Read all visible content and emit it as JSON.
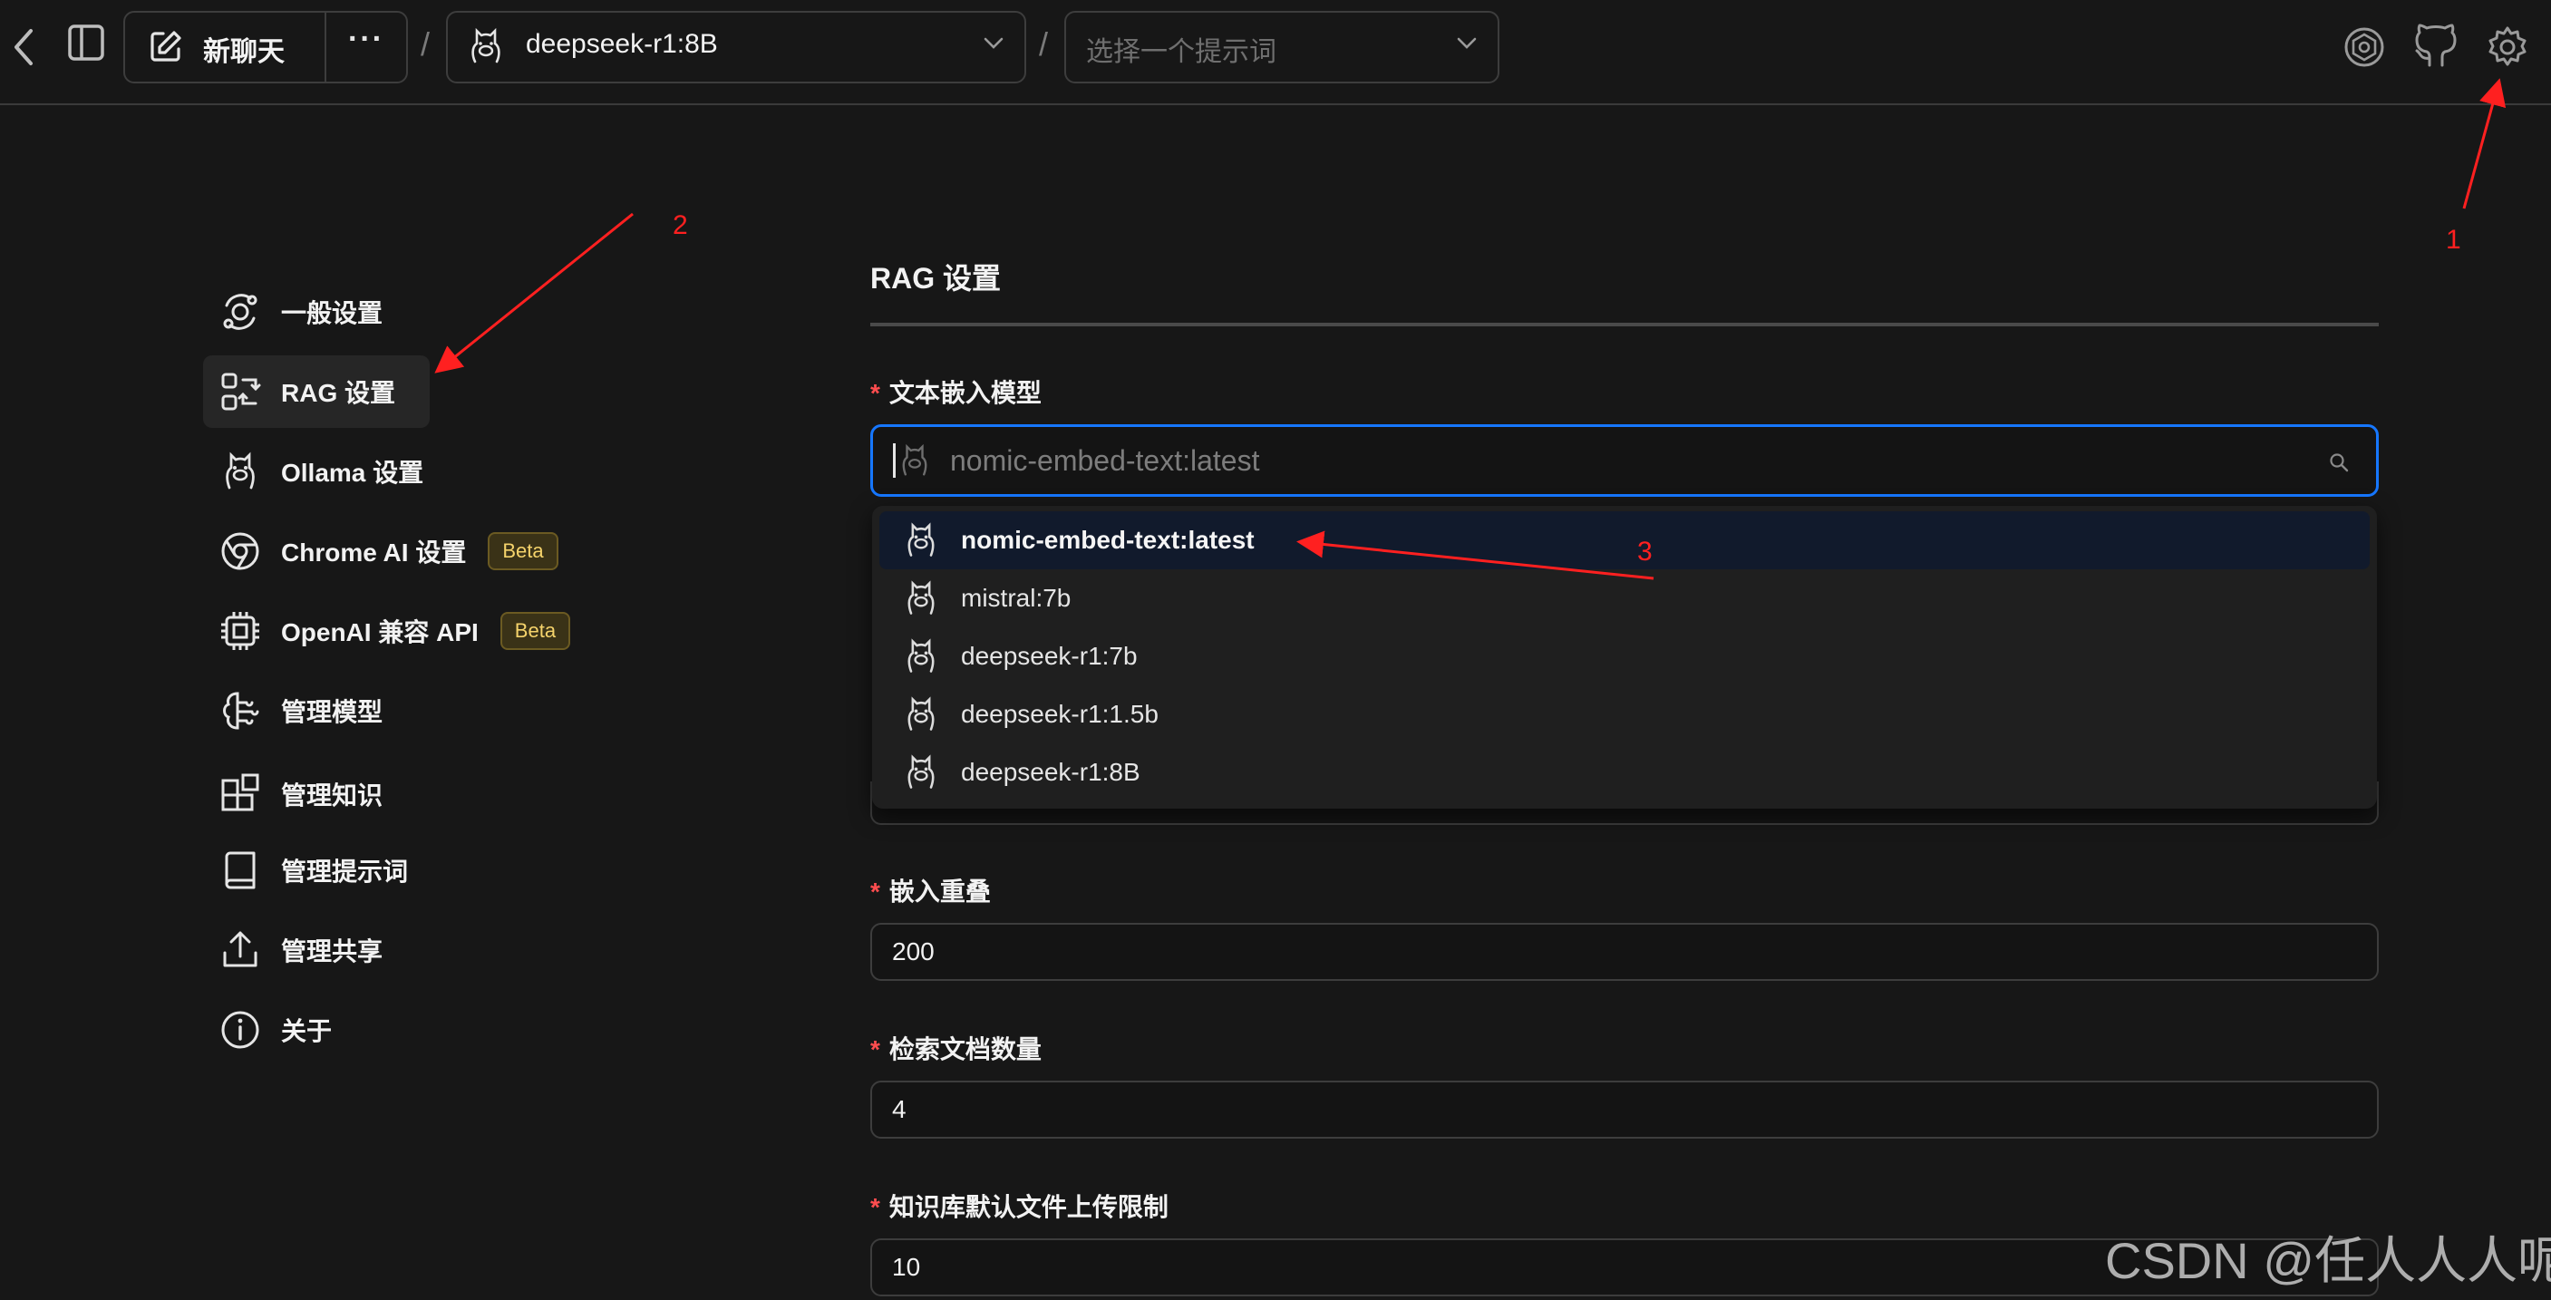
{
  "topbar": {
    "new_chat_label": "新聊天",
    "more_label": "···",
    "separator": "/",
    "model_selected": "deepseek-r1:8B",
    "prompt_placeholder": "选择一个提示词"
  },
  "sidebar": {
    "items": [
      {
        "label": "一般设置",
        "icon": "settings-orbit-icon"
      },
      {
        "label": "RAG 设置",
        "icon": "rag-icon"
      },
      {
        "label": "Ollama 设置",
        "icon": "ollama-icon"
      },
      {
        "label": "Chrome AI 设置",
        "icon": "chrome-icon",
        "badge": "Beta"
      },
      {
        "label": "OpenAI 兼容 API",
        "icon": "cpu-icon",
        "badge": "Beta"
      },
      {
        "label": "管理模型",
        "icon": "brain-icon"
      },
      {
        "label": "管理知识",
        "icon": "blocks-icon"
      },
      {
        "label": "管理提示词",
        "icon": "book-icon"
      },
      {
        "label": "管理共享",
        "icon": "share-icon"
      },
      {
        "label": "关于",
        "icon": "info-icon"
      }
    ],
    "active_index": 1
  },
  "main": {
    "title": "RAG 设置",
    "required_mark": "*",
    "embedding_label": "文本嵌入模型",
    "embedding_placeholder": "nomic-embed-text:latest",
    "dropdown_options": [
      "nomic-embed-text:latest",
      "mistral:7b",
      "deepseek-r1:7b",
      "deepseek-r1:1.5b",
      "deepseek-r1:8B"
    ],
    "dropdown_active_index": 0,
    "overlap_label": "嵌入重叠",
    "overlap_value": "200",
    "retrieval_label": "检索文档数量",
    "retrieval_value": "4",
    "upload_label": "知识库默认文件上传限制",
    "upload_value": "10"
  },
  "annotations": [
    "1",
    "2",
    "3"
  ],
  "watermark": "CSDN @任人人人呢",
  "colors": {
    "background": "#171717",
    "accent": "#1677ff",
    "annotation": "#ff2020",
    "badge": "#f5d36b"
  }
}
